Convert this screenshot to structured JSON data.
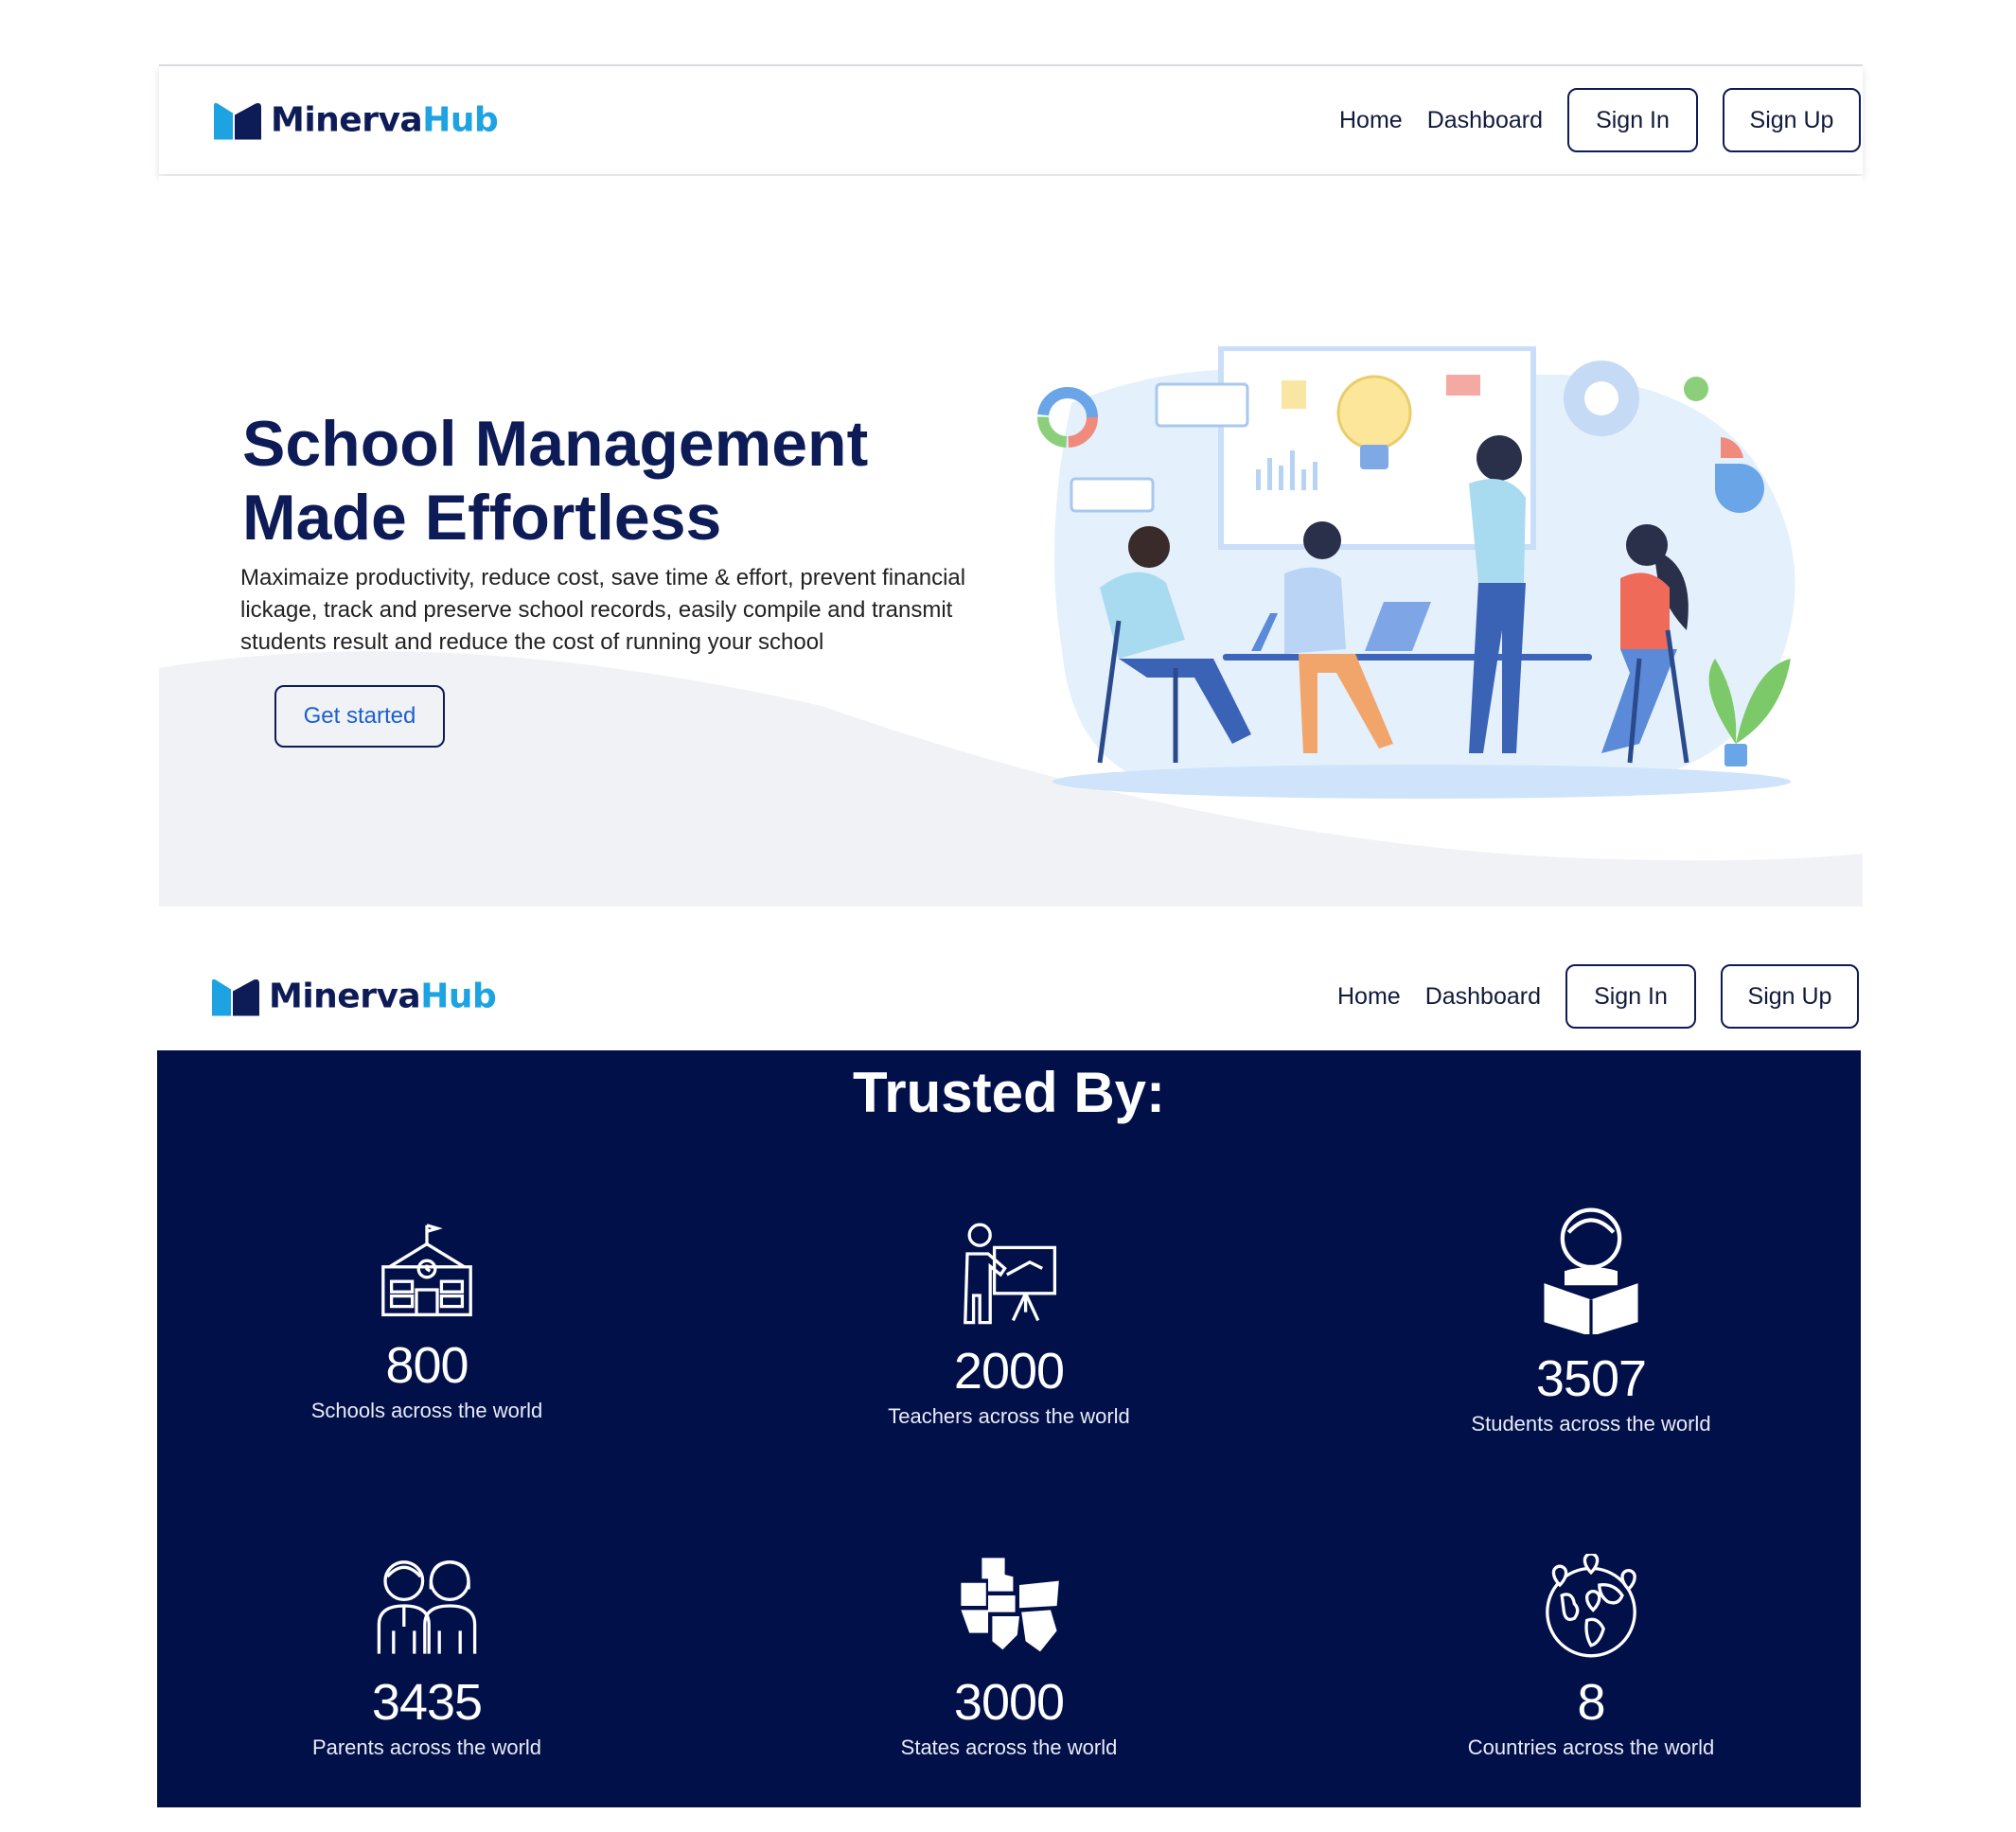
{
  "brand": {
    "name_part1": "Minerva",
    "name_part2": "Hub"
  },
  "nav": {
    "home": "Home",
    "dashboard": "Dashboard",
    "sign_in": "Sign In",
    "sign_up": "Sign Up"
  },
  "hero": {
    "title_line1": "School Management",
    "title_line2": "Made Effortless",
    "subtitle": "Maximaize productivity, reduce cost, save time & effort, prevent financial lickage, track and preserve school records, easily compile and transmit students result and reduce the cost of running your school",
    "cta": "Get started"
  },
  "trusted": {
    "title": "Trusted By:",
    "stats": [
      {
        "value": "800",
        "label": "Schools across the world",
        "icon": "school-icon"
      },
      {
        "value": "2000",
        "label": "Teachers across the world",
        "icon": "teacher-icon"
      },
      {
        "value": "3507",
        "label": "Students across the world",
        "icon": "student-icon"
      },
      {
        "value": "3435",
        "label": "Parents across the world",
        "icon": "parents-icon"
      },
      {
        "value": "3000",
        "label": "States across the world",
        "icon": "states-map-icon"
      },
      {
        "value": "8",
        "label": "Countries across the world",
        "icon": "globe-icon"
      }
    ]
  },
  "colors": {
    "navy": "#02104a",
    "brand_dark": "#0d1b57",
    "brand_light": "#1ea3e2",
    "link_blue": "#1b5fd0"
  }
}
